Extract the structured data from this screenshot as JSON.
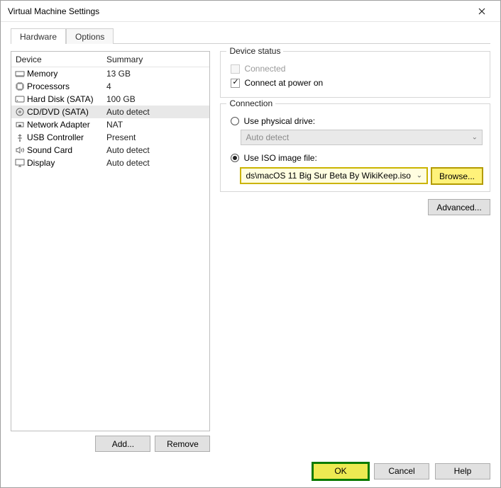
{
  "window": {
    "title": "Virtual Machine Settings"
  },
  "tabs": {
    "hardware": "Hardware",
    "options": "Options"
  },
  "device_table": {
    "header_device": "Device",
    "header_summary": "Summary",
    "rows": [
      {
        "icon": "memory-icon",
        "name": "Memory",
        "summary": "13 GB"
      },
      {
        "icon": "processors-icon",
        "name": "Processors",
        "summary": "4"
      },
      {
        "icon": "harddisk-icon",
        "name": "Hard Disk (SATA)",
        "summary": "100 GB"
      },
      {
        "icon": "cddvd-icon",
        "name": "CD/DVD (SATA)",
        "summary": "Auto detect"
      },
      {
        "icon": "network-icon",
        "name": "Network Adapter",
        "summary": "NAT"
      },
      {
        "icon": "usb-icon",
        "name": "USB Controller",
        "summary": "Present"
      },
      {
        "icon": "sound-icon",
        "name": "Sound Card",
        "summary": "Auto detect"
      },
      {
        "icon": "display-icon",
        "name": "Display",
        "summary": "Auto detect"
      }
    ],
    "selected_index": 3
  },
  "left_buttons": {
    "add": "Add...",
    "remove": "Remove"
  },
  "device_status": {
    "legend": "Device status",
    "connected_label": "Connected",
    "connected_checked": false,
    "connected_enabled": false,
    "connect_at_power_on_label": "Connect at power on",
    "connect_at_power_on_checked": true
  },
  "connection": {
    "legend": "Connection",
    "use_physical_label": "Use physical drive:",
    "use_physical_selected": false,
    "physical_drive_value": "Auto detect",
    "use_iso_label": "Use ISO image file:",
    "use_iso_selected": true,
    "iso_path_value": "ds\\macOS 11 Big Sur Beta By WikiKeep.iso",
    "browse_label": "Browse..."
  },
  "advanced_label": "Advanced...",
  "footer": {
    "ok": "OK",
    "cancel": "Cancel",
    "help": "Help"
  }
}
